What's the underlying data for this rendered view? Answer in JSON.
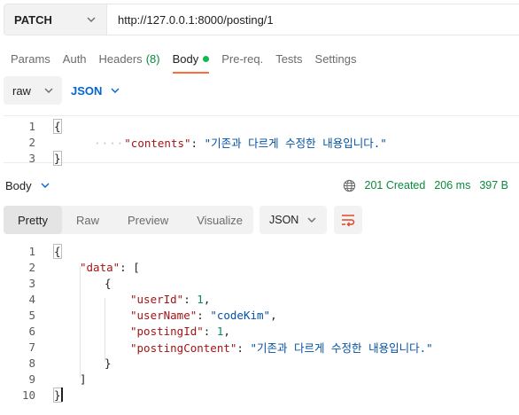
{
  "request": {
    "method": "PATCH",
    "url": "http://127.0.0.1:8000/posting/1"
  },
  "tabs": [
    {
      "label": "Params"
    },
    {
      "label": "Auth"
    },
    {
      "label": "Headers",
      "count": "(8)"
    },
    {
      "label": "Body"
    },
    {
      "label": "Pre-req."
    },
    {
      "label": "Tests"
    },
    {
      "label": "Settings"
    }
  ],
  "body_mode": {
    "raw_label": "raw",
    "format_label": "JSON"
  },
  "request_body": {
    "line_numbers": [
      "1",
      "2",
      "3"
    ],
    "open_brace": "{",
    "key": "\"contents\"",
    "colon": ": ",
    "value": "\"기존과 다르게 수정한 내용입니다.\"",
    "close_brace": "}",
    "indent_dots": "····"
  },
  "response": {
    "section_label": "Body",
    "status": "201 Created",
    "time": "206 ms",
    "size": "397 B",
    "view_tabs": [
      "Pretty",
      "Raw",
      "Preview",
      "Visualize"
    ],
    "format_label": "JSON",
    "line_numbers": [
      "1",
      "2",
      "3",
      "4",
      "5",
      "6",
      "7",
      "8",
      "9",
      "10"
    ],
    "lines": {
      "l1": "{",
      "l2_key": "\"data\"",
      "l2_rest": ": [",
      "l3": "{",
      "l4_key": "\"userId\"",
      "l4_colon": ": ",
      "l4_val": "1",
      "l4_comma": ",",
      "l5_key": "\"userName\"",
      "l5_colon": ": ",
      "l5_val": "\"codeKim\"",
      "l5_comma": ",",
      "l6_key": "\"postingId\"",
      "l6_colon": ": ",
      "l6_val": "1",
      "l6_comma": ",",
      "l7_key": "\"postingContent\"",
      "l7_colon": ": ",
      "l7_val": "\"기존과 다르게 수정한 내용입니다.\"",
      "l8": "}",
      "l9": "]",
      "l10": "}"
    }
  },
  "colors": {
    "accent_tab": "#ff6c37",
    "status_green": "#0b8a3e",
    "json_link": "#0265d2"
  }
}
